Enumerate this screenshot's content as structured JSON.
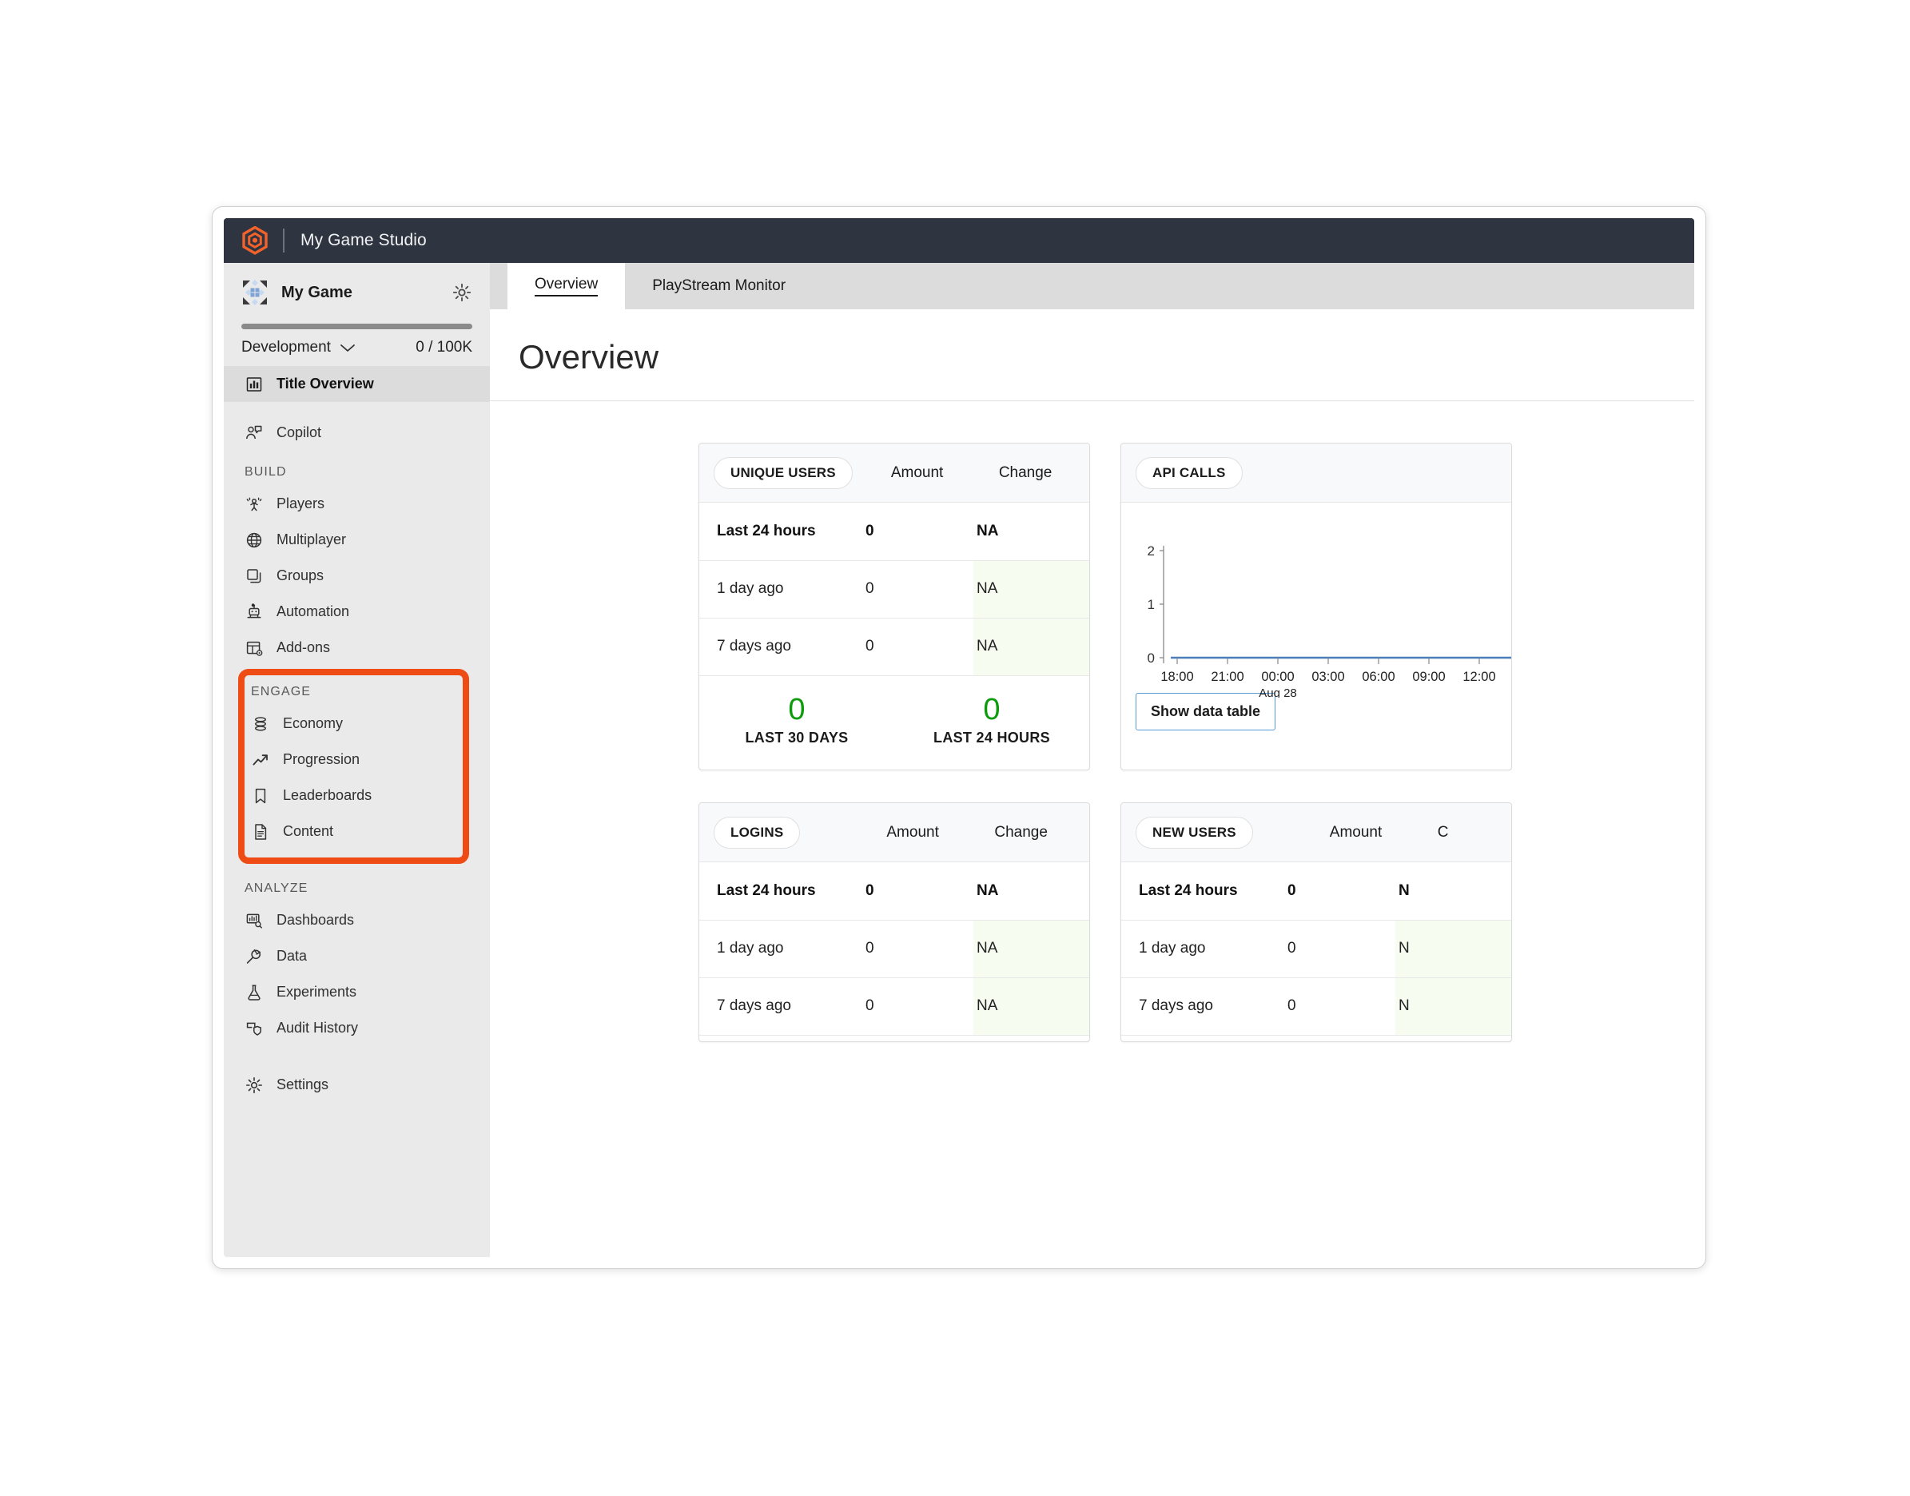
{
  "brand": {
    "logo_icon": "playfab-hexagon-logo",
    "title": "My Game Studio"
  },
  "sidebar": {
    "game": {
      "icon": "game-tile-icon",
      "name": "My Game",
      "settings_icon": "gear-icon"
    },
    "environment": {
      "name": "Development",
      "chevron_icon": "chevron-down-icon",
      "quota": "0 / 100K"
    },
    "top_items": [
      {
        "label": "Title Overview",
        "icon": "bar-chart-icon",
        "active": true
      },
      {
        "label": "Copilot",
        "icon": "copilot-person-icon",
        "active": false
      }
    ],
    "sections": [
      {
        "title": "BUILD",
        "highlighted": false,
        "items": [
          {
            "label": "Players",
            "icon": "players-icon"
          },
          {
            "label": "Multiplayer",
            "icon": "globe-icon"
          },
          {
            "label": "Groups",
            "icon": "stacked-squares-icon"
          },
          {
            "label": "Automation",
            "icon": "robot-icon"
          },
          {
            "label": "Add-ons",
            "icon": "addons-grid-icon"
          }
        ]
      },
      {
        "title": "ENGAGE",
        "highlighted": true,
        "highlight_color": "#EE4B15",
        "items": [
          {
            "label": "Economy",
            "icon": "coins-stack-icon"
          },
          {
            "label": "Progression",
            "icon": "trend-up-arrow-icon"
          },
          {
            "label": "Leaderboards",
            "icon": "bookmark-icon"
          },
          {
            "label": "Content",
            "icon": "document-icon"
          }
        ]
      },
      {
        "title": "ANALYZE",
        "highlighted": false,
        "items": [
          {
            "label": "Dashboards",
            "icon": "dashboard-search-icon"
          },
          {
            "label": "Data",
            "icon": "plug-icon"
          },
          {
            "label": "Experiments",
            "icon": "flask-icon"
          },
          {
            "label": "Audit History",
            "icon": "shield-history-icon"
          }
        ]
      }
    ],
    "footer_items": [
      {
        "label": "Settings",
        "icon": "gear-icon"
      }
    ]
  },
  "tabs": [
    {
      "label": "Overview",
      "active": true
    },
    {
      "label": "PlayStream Monitor",
      "active": false
    }
  ],
  "page": {
    "title": "Overview"
  },
  "cards": {
    "unique_users": {
      "pill": "UNIQUE USERS",
      "col_amount": "Amount",
      "col_change": "Change",
      "rows": [
        {
          "label": "Last 24 hours",
          "amount": "0",
          "change": "NA",
          "primary": true,
          "tint": false
        },
        {
          "label": "1 day ago",
          "amount": "0",
          "change": "NA",
          "primary": false,
          "tint": true
        },
        {
          "label": "7 days ago",
          "amount": "0",
          "change": "NA",
          "primary": false,
          "tint": true
        }
      ],
      "totals": [
        {
          "value": "0",
          "label": "LAST 30 DAYS"
        },
        {
          "value": "0",
          "label": "LAST 24 HOURS"
        }
      ]
    },
    "api_calls": {
      "pill": "API CALLS",
      "show_data_table_label": "Show data table"
    },
    "logins": {
      "pill": "LOGINS",
      "col_amount": "Amount",
      "col_change": "Change",
      "rows": [
        {
          "label": "Last 24 hours",
          "amount": "0",
          "change": "NA",
          "primary": true,
          "tint": false
        },
        {
          "label": "1 day ago",
          "amount": "0",
          "change": "NA",
          "primary": false,
          "tint": true
        },
        {
          "label": "7 days ago",
          "amount": "0",
          "change": "NA",
          "primary": false,
          "tint": true
        }
      ]
    },
    "new_users": {
      "pill": "NEW USERS",
      "col_amount": "Amount",
      "col_change": "C",
      "rows": [
        {
          "label": "Last 24 hours",
          "amount": "0",
          "change": "N",
          "primary": true,
          "tint": false
        },
        {
          "label": "1 day ago",
          "amount": "0",
          "change": "N",
          "primary": false,
          "tint": true
        },
        {
          "label": "7 days ago",
          "amount": "0",
          "change": "N",
          "primary": false,
          "tint": true
        }
      ]
    }
  },
  "chart_data": {
    "type": "line",
    "title": "API CALLS",
    "xlabel": "",
    "ylabel": "",
    "x": [
      "18:00",
      "21:00",
      "00:00",
      "03:00",
      "06:00",
      "09:00",
      "12:00"
    ],
    "x_sublabel": {
      "index": 2,
      "text": "Aug 28"
    },
    "y_ticks": [
      0,
      1,
      2
    ],
    "ylim": [
      0,
      2.3
    ],
    "series": [
      {
        "name": "API Calls",
        "color": "#4A7EBB",
        "values": [
          0,
          0,
          0,
          0,
          0,
          0,
          0
        ]
      }
    ],
    "grid": false,
    "legend": "none"
  },
  "colors": {
    "brand_dark": "#2E3440",
    "brand_orange": "#F2622A",
    "highlight_orange": "#EE4B15",
    "sidebar_bg": "#EAEAEA",
    "active_nav_bg": "#DCDCDC",
    "green_text": "#0B9B0B",
    "change_green": "#107C10",
    "tint_green_bg": "#F7FCF0",
    "chart_line": "#4A7EBB",
    "button_border_blue": "#5B9BD5"
  }
}
